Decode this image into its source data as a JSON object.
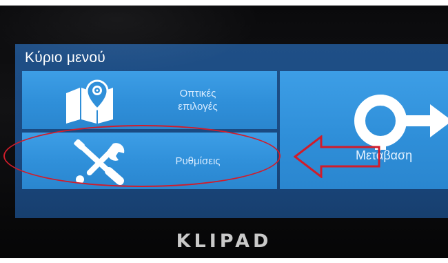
{
  "menu": {
    "title": "Κύριο μενού"
  },
  "tiles": {
    "options": {
      "label_line1": "Οπτικές",
      "label_line2": "επιλογές",
      "icon": "map-pin-icon"
    },
    "settings": {
      "label": "Ρυθμίσεις",
      "icon": "tools-icon"
    },
    "navigation": {
      "label": "Μετάβαση",
      "icon": "navigation-arrow-icon"
    }
  },
  "device": {
    "brand": "KLIPAD"
  },
  "annotation": {
    "highlight_color": "#d11c2a"
  }
}
